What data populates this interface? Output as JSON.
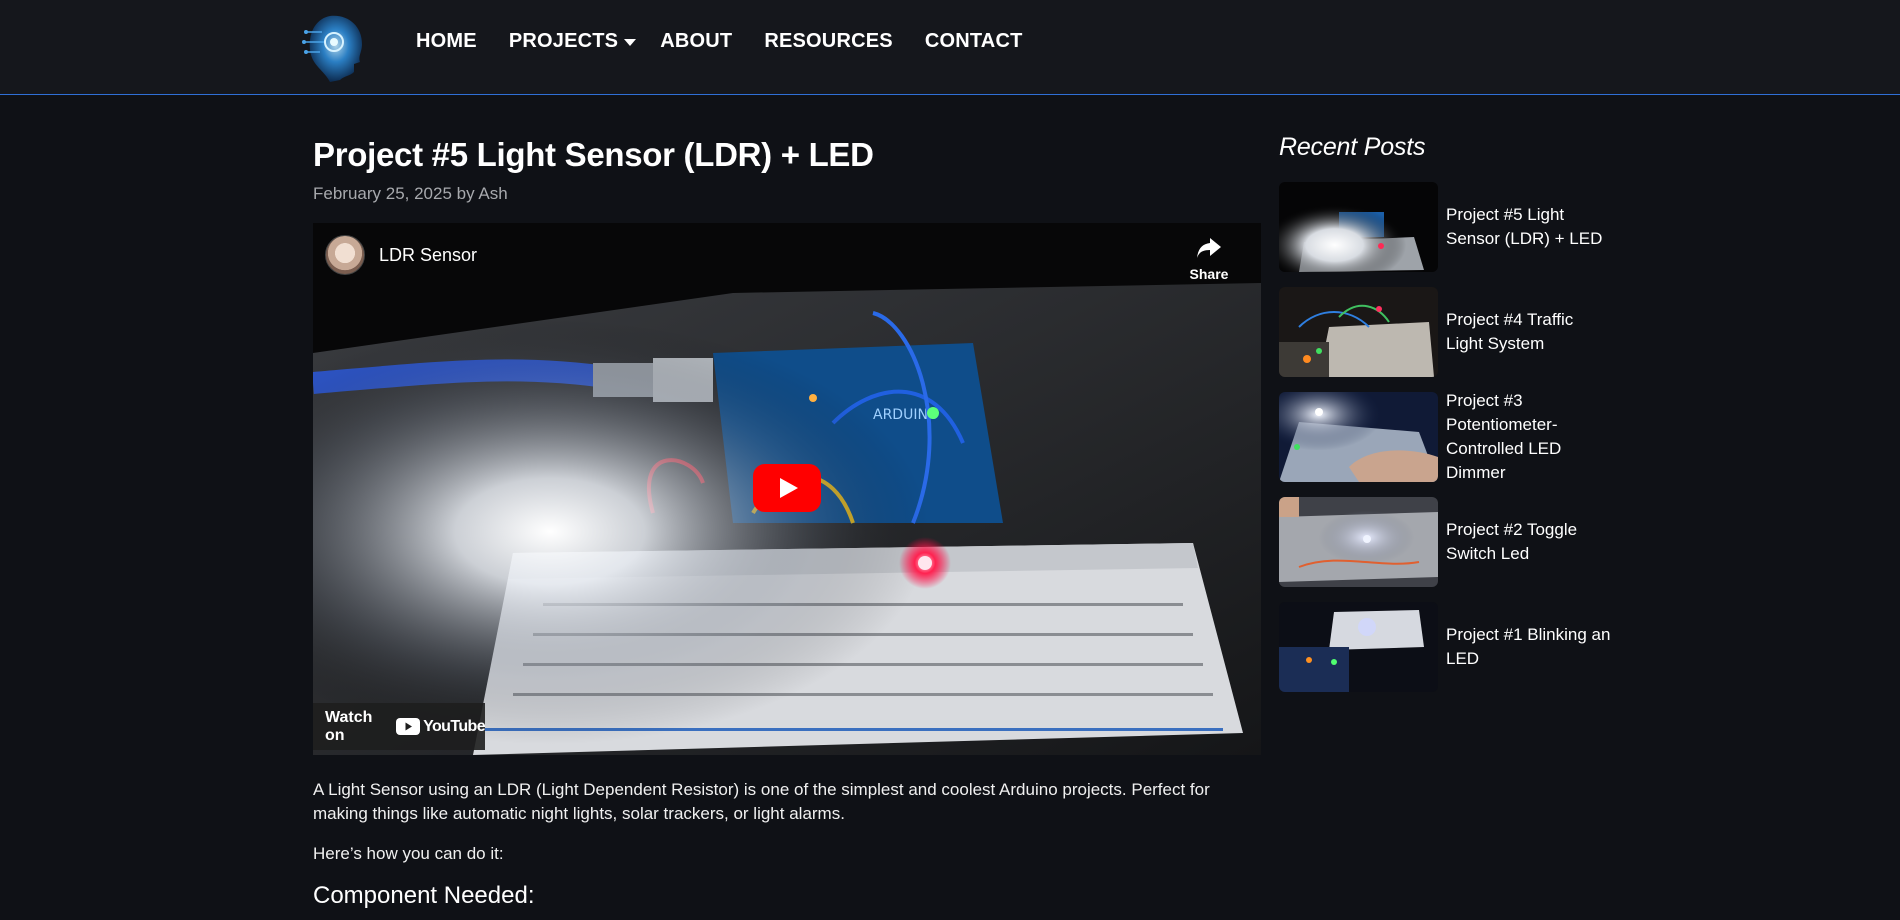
{
  "nav": {
    "items": [
      {
        "label": "HOME"
      },
      {
        "label": "PROJECTS",
        "has_dropdown": true
      },
      {
        "label": "ABOUT"
      },
      {
        "label": "RESOURCES"
      },
      {
        "label": "CONTACT"
      }
    ]
  },
  "post": {
    "title": "Project #5 Light Sensor (LDR) + LED",
    "meta": "February 25, 2025 by Ash"
  },
  "video": {
    "title": "LDR Sensor",
    "share_label": "Share",
    "watch_on_label": "Watch on",
    "youtube_word": "YouTube"
  },
  "body": {
    "paragraph_1": "A Light Sensor using an LDR (Light Dependent Resistor) is one of the simplest and coolest Arduino projects. Perfect for making things like automatic night lights, solar trackers, or light alarms.",
    "paragraph_2": "Here’s how you can do it:",
    "heading": "Component Needed:"
  },
  "sidebar": {
    "title": "Recent Posts",
    "posts": [
      {
        "label": "Project #5 Light Sensor (LDR) + LED"
      },
      {
        "label": "Project #4 Traffic Light System"
      },
      {
        "label": "Project #3 Potentiometer-Controlled LED Dimmer"
      },
      {
        "label": "Project #2 Toggle Switch Led"
      },
      {
        "label": "Project #1 Blinking an LED"
      }
    ]
  },
  "colors": {
    "background": "#0f1116",
    "header": "#15171c",
    "accent_line": "#2f6fd6",
    "youtube_red": "#ff0000"
  }
}
